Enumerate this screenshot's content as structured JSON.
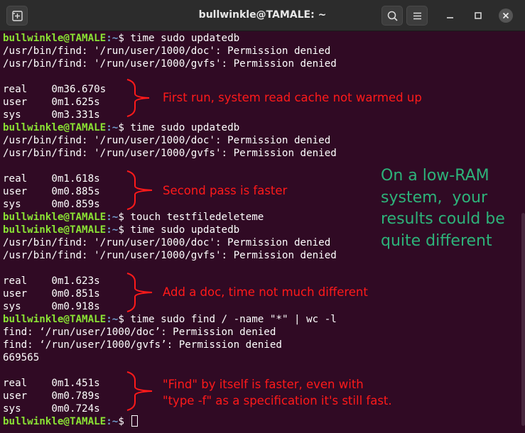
{
  "window": {
    "title": "bullwinkle@TAMALE: ~"
  },
  "titlebar": {
    "new_tab_icon": "new-tab-icon",
    "search_icon": "search-icon",
    "menu_icon": "hamburger-menu-icon",
    "minimize_icon": "minimize-icon",
    "maximize_icon": "maximize-icon",
    "close_icon": "close-icon"
  },
  "terminal": {
    "prompt_user": "bullwinkle@TAMALE",
    "prompt_path": ":~",
    "prompt_symbol": "$ ",
    "lines": [
      {
        "type": "cmd",
        "text": "time sudo updatedb"
      },
      {
        "type": "out",
        "text": "/usr/bin/find: '/run/user/1000/doc': Permission denied"
      },
      {
        "type": "out",
        "text": "/usr/bin/find: '/run/user/1000/gvfs': Permission denied"
      },
      {
        "type": "out",
        "text": ""
      },
      {
        "type": "out",
        "text": "real\t0m36.670s"
      },
      {
        "type": "out",
        "text": "user\t0m1.625s"
      },
      {
        "type": "out",
        "text": "sys\t0m3.331s"
      },
      {
        "type": "cmd",
        "text": "time sudo updatedb"
      },
      {
        "type": "out",
        "text": "/usr/bin/find: '/run/user/1000/doc': Permission denied"
      },
      {
        "type": "out",
        "text": "/usr/bin/find: '/run/user/1000/gvfs': Permission denied"
      },
      {
        "type": "out",
        "text": ""
      },
      {
        "type": "out",
        "text": "real\t0m1.618s"
      },
      {
        "type": "out",
        "text": "user\t0m0.885s"
      },
      {
        "type": "out",
        "text": "sys\t0m0.859s"
      },
      {
        "type": "cmd",
        "text": "touch testfiledeleteme"
      },
      {
        "type": "cmd",
        "text": "time sudo updatedb"
      },
      {
        "type": "out",
        "text": "/usr/bin/find: '/run/user/1000/doc': Permission denied"
      },
      {
        "type": "out",
        "text": "/usr/bin/find: '/run/user/1000/gvfs': Permission denied"
      },
      {
        "type": "out",
        "text": ""
      },
      {
        "type": "out",
        "text": "real\t0m1.623s"
      },
      {
        "type": "out",
        "text": "user\t0m0.851s"
      },
      {
        "type": "out",
        "text": "sys\t0m0.918s"
      },
      {
        "type": "cmd",
        "text": "time sudo find / -name \"*\" | wc -l"
      },
      {
        "type": "out",
        "text": "find: ‘/run/user/1000/doc’: Permission denied"
      },
      {
        "type": "out",
        "text": "find: ‘/run/user/1000/gvfs’: Permission denied"
      },
      {
        "type": "out",
        "text": "669565"
      },
      {
        "type": "out",
        "text": ""
      },
      {
        "type": "out",
        "text": "real\t0m1.451s"
      },
      {
        "type": "out",
        "text": "user\t0m0.789s"
      },
      {
        "type": "out",
        "text": "sys\t0m0.724s"
      },
      {
        "type": "cmd",
        "text": ""
      }
    ]
  },
  "annotations": {
    "first_run": "First run, system read cache not warmed up",
    "second_pass": "Second pass is faster",
    "add_doc": "Add a doc, time not much different",
    "find_line1": "\"Find\" by itself is faster, even with",
    "find_line2": "\"type -f\" as a specification it's still fast.",
    "side_note": "On a low-RAM\nsystem,  your\nresults could be\nquite different"
  },
  "colors": {
    "background": "#300a24",
    "prompt_user": "#8ae234",
    "prompt_path": "#729fcf",
    "annotation_red": "#ff1a1a",
    "note_green": "#2db37a",
    "titlebar": "#2c2c2c"
  }
}
